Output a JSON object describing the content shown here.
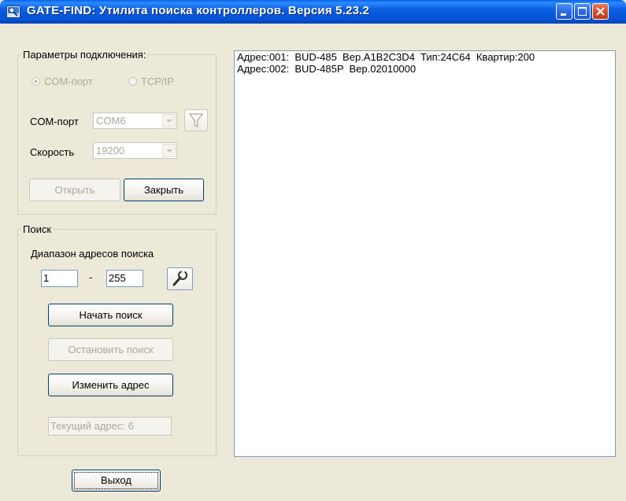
{
  "window": {
    "title": "GATE-FIND: Утилита поиска контроллеров. Версия 5.23.2",
    "colors": {
      "titlebar": "#0653D6",
      "face": "#ECE9D8",
      "close": "#DD4E2A"
    }
  },
  "connection": {
    "legend": "Параметры подключения:",
    "radio_com": "COM-порт",
    "radio_tcp": "TCP/IP",
    "radio_selected": "COM-порт",
    "com_label": "COM-порт",
    "com_value": "COM6",
    "speed_label": "Скорость",
    "speed_value": "19200",
    "open_button": "Открыть",
    "close_button": "Закрыть",
    "filter_icon": "filter-icon"
  },
  "search": {
    "legend": "Поиск",
    "range_label": "Диапазон адресов поиска",
    "range_from": "1",
    "range_separator": "-",
    "range_to": "255",
    "settings_icon": "wrench-icon",
    "start_button": "Начать поиск",
    "stop_button": "Остановить поиск",
    "change_button": "Изменить адрес",
    "current_address": "Текущий адрес: 6"
  },
  "results": [
    "Адрес:001:  BUD-485  Вер.A1B2C3D4  Тип:24C64  Квартир:200",
    "Адрес:002:  BUD-485P  Вер.02010000"
  ],
  "footer": {
    "exit_button": "Выход"
  }
}
